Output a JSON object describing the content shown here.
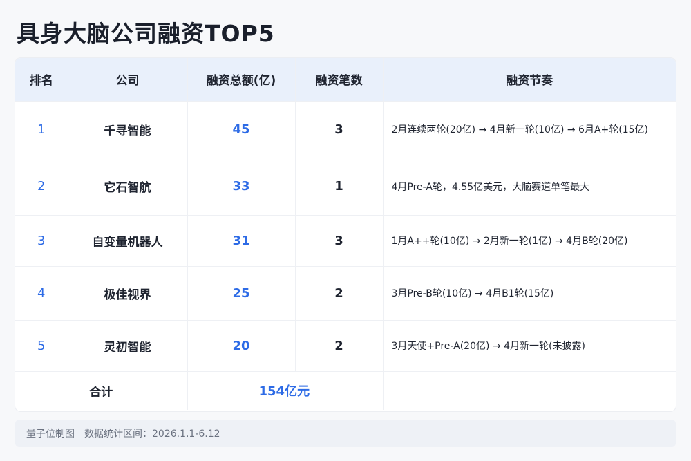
{
  "title": "具身大脑公司融资TOP5",
  "table": {
    "headers": [
      "排名",
      "公司",
      "融资总额(亿)",
      "融资笔数",
      "融资节奏"
    ],
    "rows": [
      {
        "rank": "1",
        "company": "千寻智能",
        "amount": "45",
        "count": "3",
        "rhythm": "2月连续两轮(20亿) → 4月新一轮(10亿) → 6月A+轮(15亿)"
      },
      {
        "rank": "2",
        "company": "它石智航",
        "amount": "33",
        "count": "1",
        "rhythm": "4月Pre-A轮，4.55亿美元，大脑赛道单笔最大"
      },
      {
        "rank": "3",
        "company": "自变量机器人",
        "amount": "31",
        "count": "3",
        "rhythm": "1月A++轮(10亿) → 2月新一轮(1亿) → 4月B轮(20亿)"
      },
      {
        "rank": "4",
        "company": "极佳视界",
        "amount": "25",
        "count": "2",
        "rhythm": "3月Pre-B轮(10亿) → 4月B1轮(15亿)"
      },
      {
        "rank": "5",
        "company": "灵初智能",
        "amount": "20",
        "count": "2",
        "rhythm": "3月天使+Pre-A(20亿) → 4月新一轮(未披露)"
      }
    ],
    "total": {
      "label": "合计",
      "amount": "154亿元"
    }
  },
  "footer": {
    "source": "量子位制图",
    "range": "数据统计区间：2026.1.1-6.12"
  },
  "colors": {
    "accent": "#2d6be6",
    "header_bg": "#e9f0fb"
  }
}
